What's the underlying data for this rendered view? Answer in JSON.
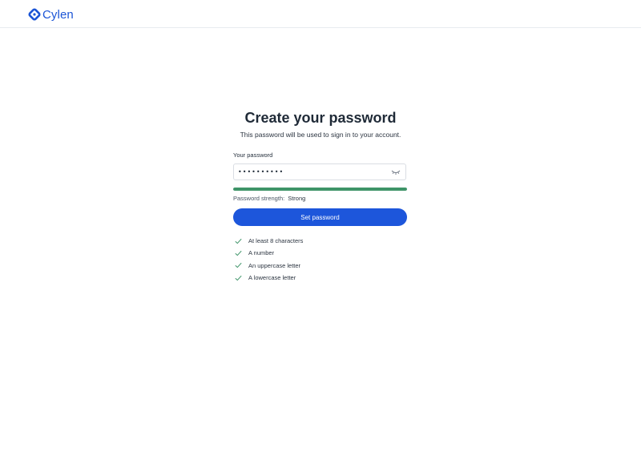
{
  "header": {
    "brand_name": "Cylen",
    "logo_icon": "cylen-logo-icon",
    "brand_color": "#1c55d6"
  },
  "form": {
    "title": "Create your password",
    "subtitle": "This password will be used to sign in to your account.",
    "password_label": "Your password",
    "password_value": "••••••••••",
    "visibility_icon": "eye-closed-icon",
    "strength_label": "Password strength:",
    "strength_value": "Strong",
    "strength_level": 1.0,
    "strength_color": "#3e9468",
    "submit_label": "Set password",
    "submit_color": "#1d56db"
  },
  "requirements": [
    {
      "label": "At least 8 characters",
      "met": true,
      "icon": "check-icon"
    },
    {
      "label": "A number",
      "met": true,
      "icon": "check-icon"
    },
    {
      "label": "An uppercase letter",
      "met": true,
      "icon": "check-icon"
    },
    {
      "label": "A lowercase letter",
      "met": true,
      "icon": "check-icon"
    }
  ]
}
